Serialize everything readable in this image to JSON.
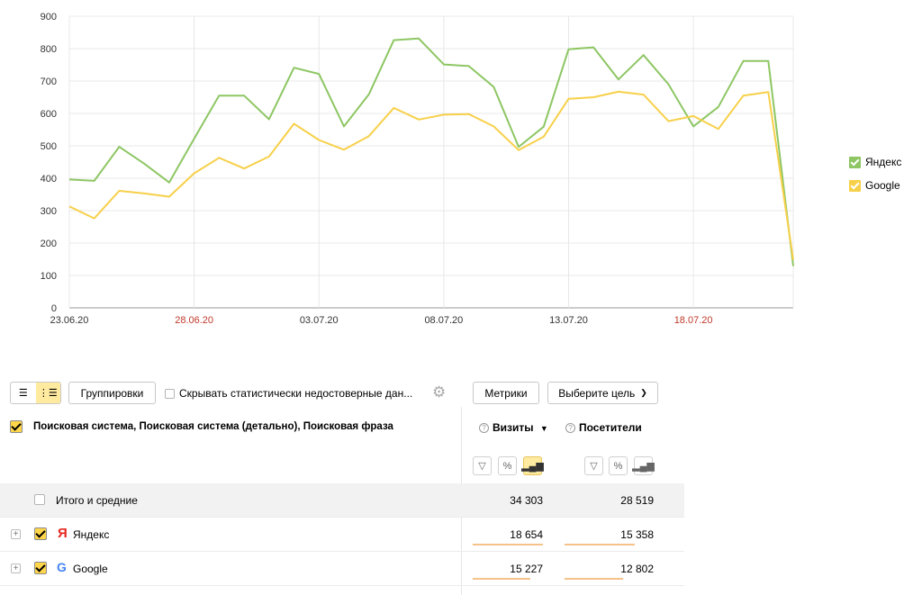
{
  "chart_data": {
    "type": "line",
    "x": [
      "23.06.20",
      "24.06.20",
      "25.06.20",
      "26.06.20",
      "27.06.20",
      "28.06.20",
      "29.06.20",
      "30.06.20",
      "01.07.20",
      "02.07.20",
      "03.07.20",
      "04.07.20",
      "05.07.20",
      "06.07.20",
      "07.07.20",
      "08.07.20",
      "09.07.20",
      "10.07.20",
      "11.07.20",
      "12.07.20",
      "13.07.20",
      "14.07.20",
      "15.07.20",
      "16.07.20",
      "17.07.20",
      "18.07.20",
      "19.07.20",
      "20.07.20",
      "21.07.20",
      "22.07.20"
    ],
    "tick_labels": [
      {
        "label": "23.06.20",
        "index": 0,
        "color": "#333333"
      },
      {
        "label": "28.06.20",
        "index": 5,
        "color": "#c0392b"
      },
      {
        "label": "03.07.20",
        "index": 10,
        "color": "#333333"
      },
      {
        "label": "08.07.20",
        "index": 15,
        "color": "#333333"
      },
      {
        "label": "13.07.20",
        "index": 20,
        "color": "#333333"
      },
      {
        "label": "18.07.20",
        "index": 25,
        "color": "#c0392b"
      }
    ],
    "y_ticks": [
      0,
      100,
      200,
      300,
      400,
      500,
      600,
      700,
      800,
      900
    ],
    "ylim": [
      0,
      900
    ],
    "grid": true,
    "legend_position": "right",
    "series": [
      {
        "name": "Яндекс",
        "color": "#8dc663",
        "values": [
          396,
          392,
          497,
          445,
          387,
          522,
          655,
          655,
          582,
          741,
          722,
          560,
          659,
          826,
          831,
          751,
          746,
          682,
          497,
          559,
          798,
          804,
          705,
          780,
          690,
          560,
          620,
          762,
          762,
          129
        ]
      },
      {
        "name": "Google",
        "color": "#f7d04a",
        "values": [
          313,
          276,
          361,
          353,
          343,
          415,
          463,
          430,
          467,
          568,
          518,
          488,
          530,
          617,
          581,
          596,
          598,
          560,
          487,
          528,
          645,
          650,
          667,
          658,
          576,
          592,
          552,
          655,
          666,
          148
        ]
      }
    ]
  },
  "toolbar": {
    "groupings_label": "Группировки",
    "hide_label": "Скрывать статистически недостоверные дан...",
    "metrics_label": "Метрики",
    "goal_label": "Выберите цель"
  },
  "table": {
    "dimension_header": "Поисковая система, Поисковая система (детально), Поисковая фраза",
    "metric_visits": "Визиты",
    "sort_indicator": "▼",
    "metric_visitors": "Посетители",
    "total": {
      "label": "Итого и средние",
      "visits": "34 303",
      "visitors": "28 519"
    },
    "rows": [
      {
        "label": "Яндекс",
        "icon": "yandex-logo",
        "visits": "18 654",
        "visitors": "15 358",
        "visits_share": 0.544,
        "visitors_share": 0.539
      },
      {
        "label": "Google",
        "icon": "google-logo",
        "visits": "15 227",
        "visitors": "12 802",
        "visits_share": 0.444,
        "visitors_share": 0.449
      }
    ]
  }
}
